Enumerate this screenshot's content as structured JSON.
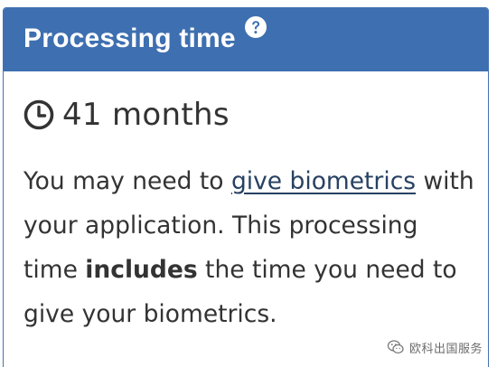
{
  "panel": {
    "title": "Processing time",
    "help_icon": "question-circle-icon",
    "header_color": "#3e6fb0"
  },
  "processing": {
    "clock_icon": "clock-icon",
    "duration": "41 months"
  },
  "info": {
    "prefix": "You may need to ",
    "link_text": "give biometrics",
    "middle": " with your application. This processing time ",
    "bold_text": "includes",
    "suffix": " the time you need to give your biometrics."
  },
  "watermark": {
    "icon": "wechat-icon",
    "text": "欧科出国服务"
  }
}
